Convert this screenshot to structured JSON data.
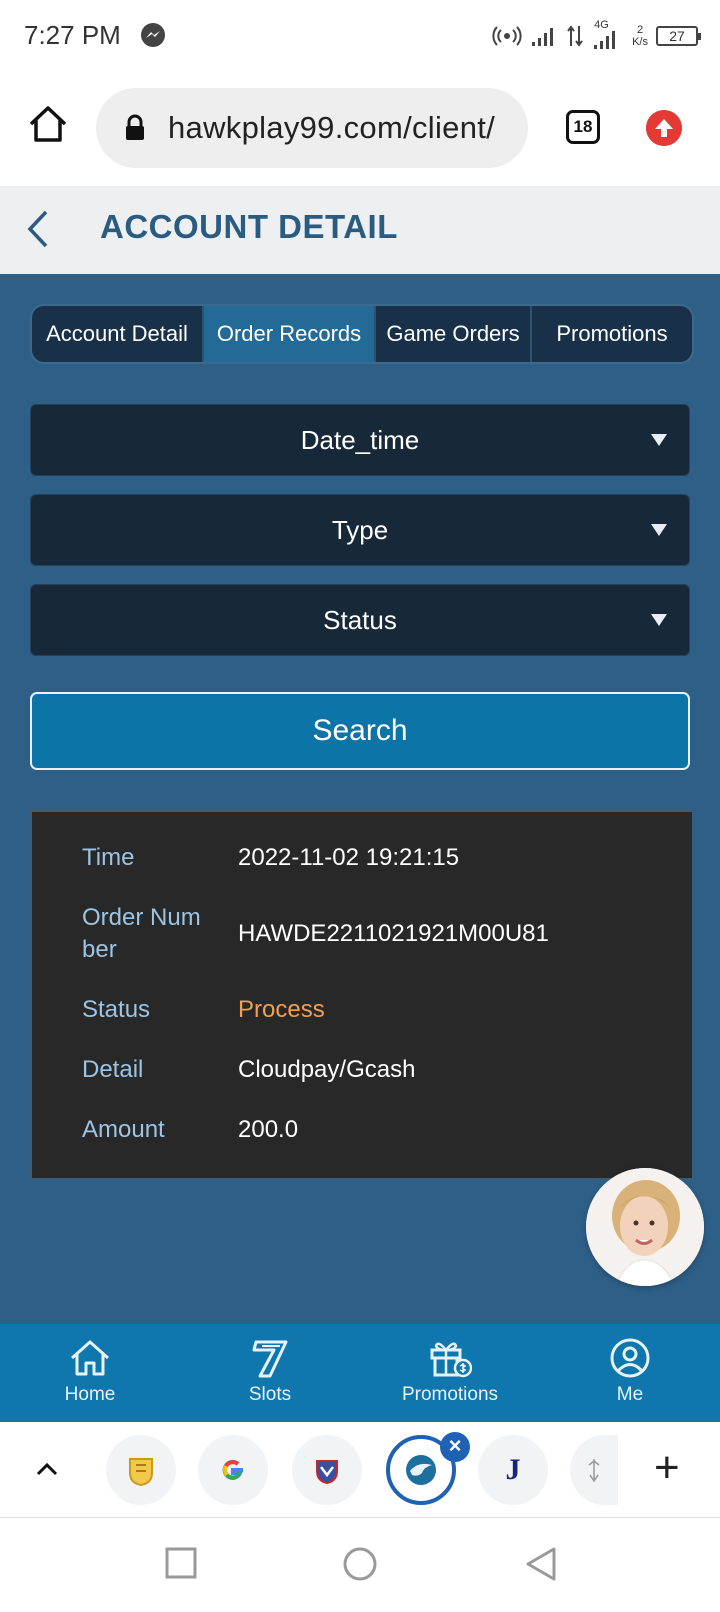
{
  "status_bar": {
    "time": "7:27 PM",
    "network_label": "4G",
    "speed_value": "2",
    "speed_unit": "K/s",
    "battery": "27"
  },
  "browser": {
    "url": "hawkplay99.com/client/",
    "tab_count": "18"
  },
  "header": {
    "title": "ACCOUNT DETAIL"
  },
  "tabs": [
    {
      "label": "Account Detail"
    },
    {
      "label": "Order Records",
      "active": true
    },
    {
      "label": "Game Orders"
    },
    {
      "label": "Promotions"
    }
  ],
  "filters": {
    "date_time": "Date_time",
    "type": "Type",
    "status": "Status"
  },
  "search_label": "Search",
  "record": {
    "time_label": "Time",
    "time_value": "2022-11-02 19:21:15",
    "order_label_line1": "Order Num",
    "order_label_line2": "ber",
    "order_value": "HAWDE2211021921M00U81",
    "status_label": "Status",
    "status_value": "Process",
    "detail_label": "Detail",
    "detail_value": "Cloudpay/Gcash",
    "amount_label": "Amount",
    "amount_value": "200.0"
  },
  "bottom_nav": [
    {
      "label": "Home",
      "icon": "home-icon"
    },
    {
      "label": "Slots",
      "icon": "slots-icon"
    },
    {
      "label": "Promotions",
      "icon": "gift-icon"
    },
    {
      "label": "Me",
      "icon": "user-icon"
    }
  ],
  "tab_strip": {
    "letter_tab": "J"
  },
  "colors": {
    "main_bg": "#2e5f87",
    "active_tab": "#236a96",
    "title": "#2a5c82",
    "status_process": "#f0a050",
    "nav_bg": "#0f77ad"
  }
}
